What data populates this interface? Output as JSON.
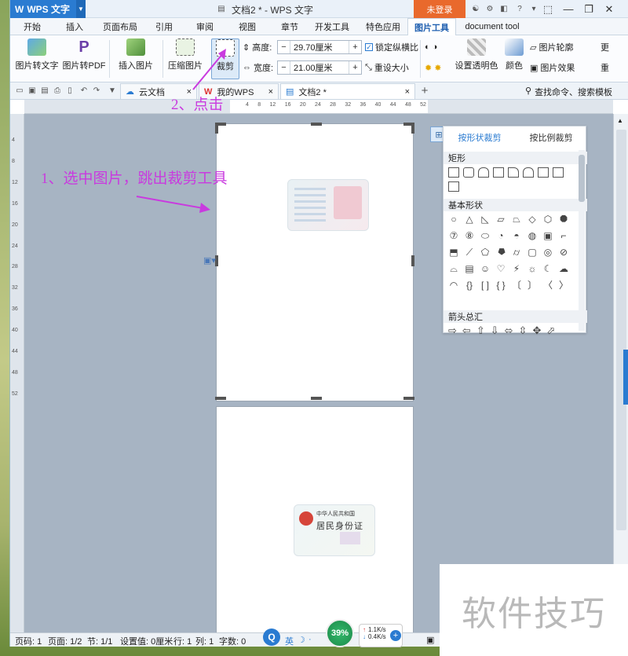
{
  "app": {
    "logo_text": "WPS 文字",
    "window_title": "文档2 * - WPS 文字",
    "login_label": "未登录"
  },
  "menu_tabs": [
    "开始",
    "插入",
    "页面布局",
    "引用",
    "审阅",
    "视图",
    "章节",
    "开发工具",
    "特色应用",
    "图片工具",
    "document tool"
  ],
  "ribbon": {
    "pic_to_text": "图片转文字",
    "pic_to_pdf": "图片转PDF",
    "insert_pic": "插入图片",
    "compress_pic": "压缩图片",
    "crop": "裁剪",
    "height_label": "高度:",
    "height_value": "29.70厘米",
    "width_label": "宽度:",
    "width_value": "21.00厘米",
    "lock_ratio": "锁定纵横比",
    "reset_size": "重设大小",
    "set_transparent": "设置透明色",
    "color": "颜色",
    "pic_outline": "图片轮廓",
    "pic_effect": "图片效果",
    "more_1": "更",
    "more_2": "重"
  },
  "doc_tabs": [
    {
      "label": "云文档"
    },
    {
      "label": "我的WPS"
    },
    {
      "label": "文档2 *"
    }
  ],
  "search_cmd": "查找命令、搜索模板",
  "ruler_numbers": [
    "4",
    "8",
    "12",
    "16",
    "20",
    "24",
    "28",
    "32",
    "36",
    "40",
    "44",
    "48",
    "52"
  ],
  "vruler_numbers": [
    "4",
    "8",
    "12",
    "16",
    "20",
    "24",
    "28",
    "32",
    "36",
    "40",
    "44",
    "48",
    "52"
  ],
  "shape_panel": {
    "tab_shape": "按形状裁剪",
    "tab_ratio": "按比例裁剪",
    "section_rect": "矩形",
    "section_basic": "基本形状",
    "section_arrows": "箭头总汇"
  },
  "annotations": {
    "step1": "1、选中图片，跳出裁剪工具",
    "step2": "2、点击"
  },
  "id_card": {
    "line1": "中华人民共和国",
    "line2": "居民身份证"
  },
  "status": {
    "page": "页码: 1",
    "pages": "页面: 1/2",
    "section": "节: 1/1",
    "setting": "设置值: 0厘米",
    "row": "行: 1",
    "col": "列: 1",
    "chars": "字数: 0",
    "ime": "英",
    "battery": "39%",
    "up_speed": "1.1K/s",
    "down_speed": "0.4K/s"
  },
  "watermark": "软件技巧",
  "colors": {
    "accent": "#2a7bd1",
    "login": "#e9692c",
    "annotation": "#c93adf"
  }
}
